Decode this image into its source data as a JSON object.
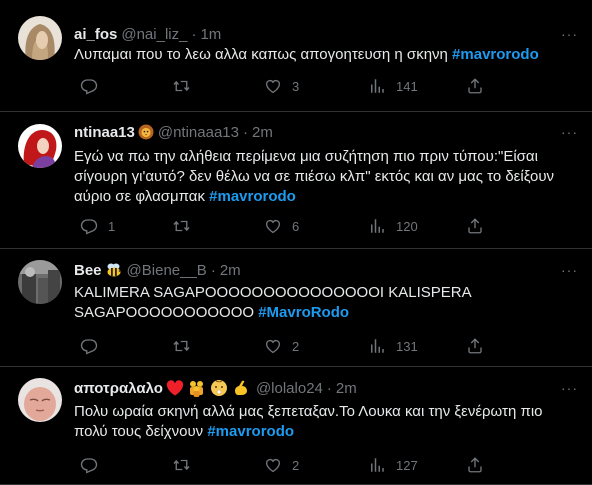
{
  "tweets": [
    {
      "name": "ai_fos",
      "handle": "@nai_liz_",
      "time": "1m",
      "text": "Λυπαμαι που το λεω αλλα καπως απογοητευση η σκηνη",
      "hashtag": "#mavrorodo",
      "replies": "",
      "likes": "3",
      "views": "141",
      "avatar_color": "#b59a7a"
    },
    {
      "name": "ntinaa13",
      "name_emoji": "lion-emoji",
      "handle": "@ntinaaa13",
      "time": "2m",
      "text": "Εγώ να πω την αλήθεια περίμενα μια συζήτηση πιο πριν τύπου:\"Είσαι σίγουρη γι'αυτό? δεν θέλω να σε πιέσω κλπ\" εκτός και αν μας το δείξουν αύριο σε φλασμπακ",
      "hashtag": "#mavrorodo",
      "replies": "1",
      "likes": "6",
      "views": "120",
      "avatar_color": "#c01818"
    },
    {
      "name": "Bee",
      "name_emoji": "bee-emoji",
      "handle": "@Biene__B",
      "time": "2m",
      "text": "KALIMERA SAGAPOOOOOOOOOOOOOOOI KALISPERA SAGAPOOOOOOOOOOO",
      "hashtag": "#MavroRodo",
      "replies": "",
      "likes": "2",
      "views": "131",
      "avatar_color": "#8a8a8a"
    },
    {
      "name": "αποτραλαλο",
      "name_emoji": "heart-babies-muscle-emoji",
      "handle": "@lolalo24",
      "time": "2m",
      "text": "Πολυ ωραία σκηνή αλλά μας ξεπεταξαν.Το Λουκα και την ξενέρωτη πιο πολύ τους δείχνουν",
      "hashtag": "#mavrorodo",
      "replies": "",
      "likes": "2",
      "views": "127",
      "avatar_color": "#d8a9a0"
    }
  ],
  "more_label": "···",
  "icons": {
    "reply": "reply-icon",
    "retweet": "retweet-icon",
    "like": "heart-icon",
    "views": "views-icon",
    "share": "share-icon"
  },
  "colors": {
    "background": "#000000",
    "text": "#e7e9ea",
    "muted": "#71767b",
    "hashtag": "#1d9bf0",
    "divider": "#2f3336"
  }
}
